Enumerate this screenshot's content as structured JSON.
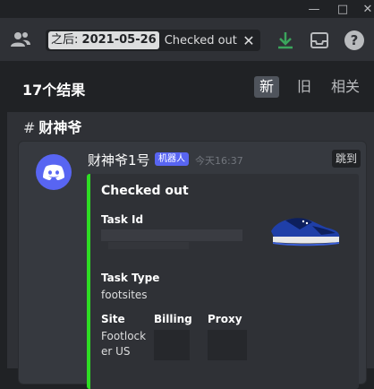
{
  "window": {
    "minimize_glyph": "—",
    "maximize_glyph": "□",
    "close_glyph": "✕"
  },
  "toolbar": {
    "search": {
      "filter_label": "之后:",
      "filter_value": "2021-05-26",
      "query": "Checked out",
      "clear_glyph": "✕"
    },
    "icons": [
      "members-icon",
      "download-icon",
      "inbox-icon",
      "help-icon"
    ],
    "help_glyph": "?"
  },
  "results": {
    "count_label": "17个结果",
    "sort": {
      "new": "新",
      "old": "旧",
      "relevant": "相关",
      "active": "new"
    },
    "channel": {
      "hash": "#",
      "name": "财神爷"
    }
  },
  "message": {
    "author": "财神爷1号",
    "bot_tag": "机器人",
    "timestamp": "今天16:37",
    "jump_label": "跳到",
    "embed": {
      "accent_color": "#2edd24",
      "title": "Checked out",
      "fields": {
        "task_id_name": "Task Id",
        "task_type_name": "Task Type",
        "task_type_value": "footsites",
        "site_name": "Site",
        "site_value": "Footlock er US",
        "billing_name": "Billing",
        "proxy_name": "Proxy"
      },
      "thumbnail": "blue-sneaker-image"
    }
  },
  "colors": {
    "background": "#202225",
    "panel": "#2f3136",
    "card": "#36393f",
    "blurple": "#5865f2",
    "download_green": "#3ba55c",
    "embed_green": "#2edd24"
  }
}
